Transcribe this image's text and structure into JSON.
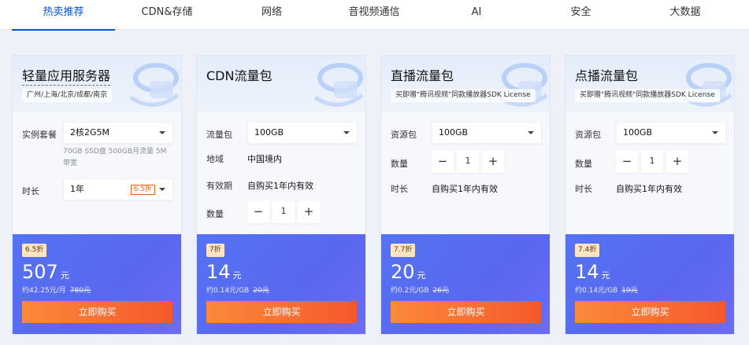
{
  "tabs": [
    "热卖推荐",
    "CDN&存储",
    "网络",
    "音视频通信",
    "AI",
    "安全",
    "大数据"
  ],
  "cards": [
    {
      "title": "轻量应用服务器",
      "subtitle": "广州/上海/北京/成都/南京",
      "spec_label": "实例套餐",
      "spec_value": "2核2G5M",
      "spec_note": "70GB SSD盘 500GB月流量 5M带宽",
      "duration_label": "时长",
      "duration_value": "1年",
      "duration_tag": "6.5折",
      "discount": "6.5折",
      "price": "507",
      "price_unit": "元",
      "unit_price": "约42.25元/月",
      "original_price": "780元",
      "buy_label": "立即购买"
    },
    {
      "title": "CDN流量包",
      "pack_label": "流量包",
      "pack_value": "100GB",
      "region_label": "地域",
      "region_value": "中国境内",
      "validity_label": "有效期",
      "validity_value": "自购买1年内有效",
      "qty_label": "数量",
      "qty_value": "1",
      "discount": "7折",
      "price": "14",
      "price_unit": "元",
      "unit_price": "约0.14元/GB",
      "original_price": "20元",
      "buy_label": "立即购买"
    },
    {
      "title": "直播流量包",
      "subtitle": "买即赠\"腾讯视频\"同款播放器SDK License",
      "pack_label": "资源包",
      "pack_value": "100GB",
      "qty_label": "数量",
      "qty_value": "1",
      "duration_label": "时长",
      "duration_value": "自购买1年内有效",
      "discount": "7.7折",
      "price": "20",
      "price_unit": "元",
      "unit_price": "约0.2元/GB",
      "original_price": "26元",
      "buy_label": "立即购买"
    },
    {
      "title": "点播流量包",
      "subtitle": "买即赠\"腾讯视频\"同款播放器SDK License",
      "pack_label": "资源包",
      "pack_value": "100GB",
      "qty_label": "数量",
      "qty_value": "1",
      "duration_label": "时长",
      "duration_value": "自购买1年内有效",
      "discount": "7.4折",
      "price": "14",
      "price_unit": "元",
      "unit_price": "约0.14元/GB",
      "original_price": "19元",
      "buy_label": "立即购买"
    }
  ],
  "stepper": {
    "minus": "−",
    "plus": "+"
  },
  "colors": {
    "accent": "#0052d9",
    "buy": "#f5582c",
    "footer": "#5a67f0"
  }
}
